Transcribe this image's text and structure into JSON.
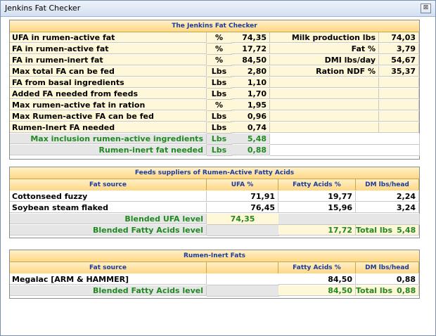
{
  "window": {
    "title": "Jenkins Fat Checker",
    "close_label": "⊠"
  },
  "checker": {
    "title": "The Jenkins Fat Checker",
    "rows": [
      {
        "label": "UFA in rumen-active fat",
        "unit": "%",
        "value": "74,35",
        "rlabel": "Milk production lbs",
        "rvalue": "74,03"
      },
      {
        "label": "FA in rumen-active fat",
        "unit": "%",
        "value": "17,72",
        "rlabel": "Fat %",
        "rvalue": "3,79"
      },
      {
        "label": "FA in rumen-inert fat",
        "unit": "%",
        "value": "84,50",
        "rlabel": "DMI lbs/day",
        "rvalue": "54,67"
      },
      {
        "label": "Max total FA can be fed",
        "unit": "Lbs",
        "value": "2,80",
        "rlabel": "Ration NDF %",
        "rvalue": "35,37"
      },
      {
        "label": "FA from basal ingredients",
        "unit": "Lbs",
        "value": "1,10",
        "rlabel": "",
        "rvalue": ""
      },
      {
        "label": "Added FA needed from feeds",
        "unit": "Lbs",
        "value": "1,70",
        "rlabel": "",
        "rvalue": ""
      },
      {
        "label": "Max rumen-active fat in ration",
        "unit": "%",
        "value": "1,95",
        "rlabel": "",
        "rvalue": ""
      },
      {
        "label": "Max Rumen-active FA can be fed",
        "unit": "Lbs",
        "value": "0,96",
        "rlabel": "",
        "rvalue": ""
      },
      {
        "label": "Rumen-Inert FA needed",
        "unit": "Lbs",
        "value": "0,74",
        "rlabel": "",
        "rvalue": ""
      }
    ],
    "summary": [
      {
        "label": "Max inclusion rumen-active ingredients",
        "unit": "Lbs",
        "value": "5,48"
      },
      {
        "label": "Rumen-inert fat needed",
        "unit": "Lbs",
        "value": "0,88"
      }
    ]
  },
  "active": {
    "title": "Feeds suppliers  of  Rumen-Active Fatty Acids",
    "headers": [
      "Fat source",
      "UFA %",
      "Fatty Acids %",
      "DM lbs/head"
    ],
    "rows": [
      {
        "source": "Cottonseed fuzzy",
        "ufa": "71,91",
        "fa": "19,77",
        "dm": "2,24"
      },
      {
        "source": "Soybean steam flaked",
        "ufa": "76,45",
        "fa": "15,96",
        "dm": "3,24"
      }
    ],
    "blended_ufa_label": "Blended UFA level",
    "blended_ufa_value": "74,35",
    "blended_fa_label": "Blended Fatty Acids level",
    "blended_fa_value": "17,72",
    "total_label": "Total lbs",
    "total_value": "5,48"
  },
  "inert": {
    "title": "Rumen-Inert Fats",
    "headers": [
      "Fat source",
      "",
      "Fatty Acids %",
      "DM lbs/head"
    ],
    "rows": [
      {
        "source": "Megalac  [ARM & HAMMER]",
        "fa": "84,50",
        "dm": "0,88"
      }
    ],
    "blended_fa_label": "Blended Fatty Acids level",
    "blended_fa_value": "84,50",
    "total_label": "Total lbs",
    "total_value": "0,88"
  }
}
